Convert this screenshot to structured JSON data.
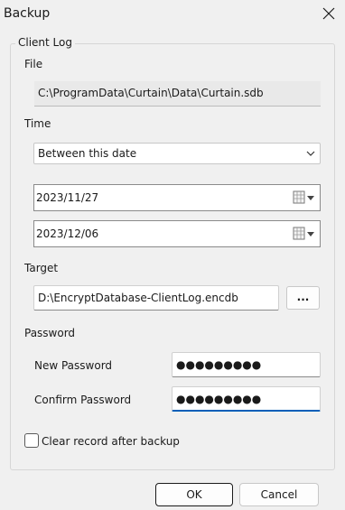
{
  "window": {
    "title": "Backup"
  },
  "group": {
    "label": "Client Log"
  },
  "file": {
    "label": "File",
    "value": "C:\\ProgramData\\Curtain\\Data\\Curtain.sdb"
  },
  "time": {
    "label": "Time",
    "mode": "Between this date",
    "start_date": "2023/11/27",
    "end_date": "2023/12/06"
  },
  "target": {
    "label": "Target",
    "value": "D:\\EncryptDatabase-ClientLog.encdb",
    "browse_label": "..."
  },
  "password": {
    "section_label": "Password",
    "new_label": "New Password",
    "new_value": "●●●●●●●●●",
    "confirm_label": "Confirm Password",
    "confirm_value": "●●●●●●●●●"
  },
  "options": {
    "clear_label": "Clear record after backup",
    "clear_checked": false
  },
  "buttons": {
    "ok": "OK",
    "cancel": "Cancel"
  },
  "icons": {
    "close": "close-icon",
    "dropdown": "chevron-down-icon",
    "calendar": "calendar-icon"
  }
}
